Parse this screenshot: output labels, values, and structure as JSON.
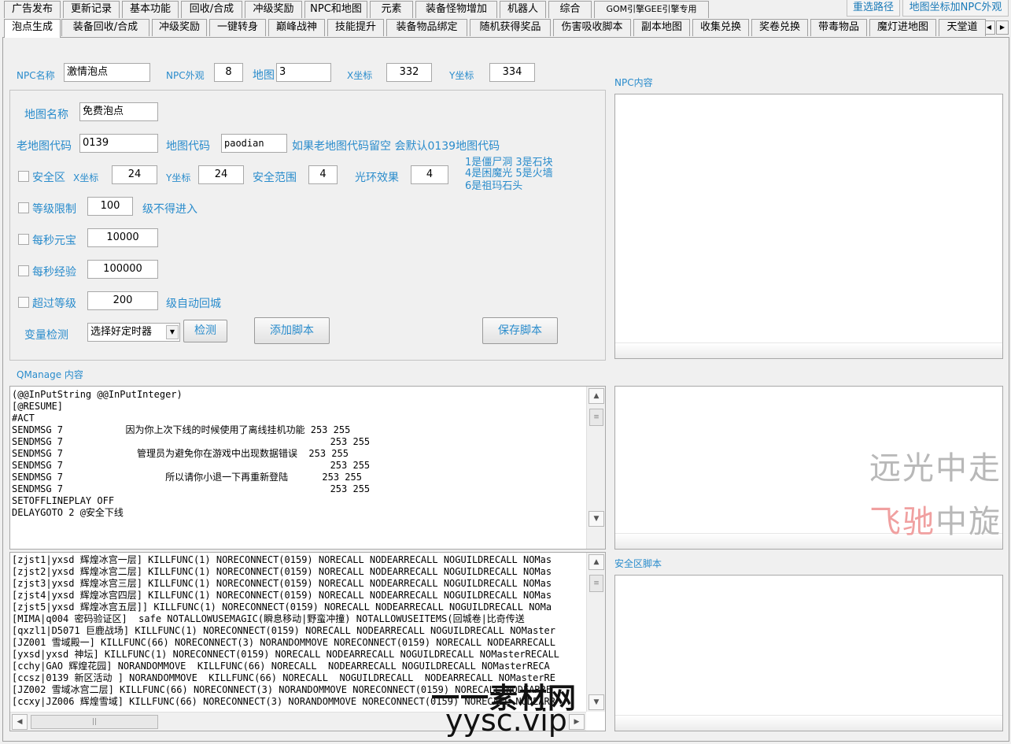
{
  "tabs_row1": [
    "广告发布",
    "更新记录",
    "基本功能",
    "回收/合成",
    "冲级奖励",
    "NPC和地图",
    "元素",
    "装备怪物增加",
    "机器人",
    "综合",
    "GOM引擎GEE引擎专用"
  ],
  "tabs_row1_right": [
    "重选路径",
    "地图坐标加NPC外观"
  ],
  "tabs_row2": [
    "泡点生成",
    "装备回收/合成",
    "冲级奖励",
    "一键转身",
    "巅峰战神",
    "技能提升",
    "装备物品绑定",
    "随机获得奖品",
    "伤害吸收脚本",
    "副本地图",
    "收集兑换",
    "奖卷兑换",
    "带毒物品",
    "魔灯进地图",
    "天堂道"
  ],
  "tab_scroll": {
    "left": "◀",
    "right": "▶"
  },
  "npc": {
    "name_label": "NPC名称",
    "name_value": "激情泡点",
    "look_label": "NPC外观",
    "look_value": "8",
    "map_label": "地图",
    "map_value": "3",
    "x_label": "X坐标",
    "x_value": "332",
    "y_label": "Y坐标",
    "y_value": "334",
    "content_label": "NPC内容"
  },
  "group": {
    "map_name_label": "地图名称",
    "map_name_value": "免费泡点",
    "old_map_code_label": "老地图代码",
    "old_map_code_value": "0139",
    "map_code_label": "地图代码",
    "map_code_value": "paodian",
    "hint": "如果老地图代码留空 会默认0139地图代码",
    "safe_label": "安全区",
    "safe_x_label": "X坐标",
    "safe_x_value": "24",
    "safe_y_label": "Y坐标",
    "safe_y_value": "24",
    "safe_range_label": "安全范围",
    "safe_range_value": "4",
    "halo_label": "光环效果",
    "halo_value": "4",
    "halo_hint": [
      "1是僵尸洞 3是石块",
      "4是困魔光 5是火墙",
      "6是祖玛石头"
    ],
    "level_limit_label": "等级限制",
    "level_limit_value": "100",
    "level_limit_suffix": "级不得进入",
    "yb_label": "每秒元宝",
    "yb_value": "10000",
    "exp_label": "每秒经验",
    "exp_value": "100000",
    "over_label": "超过等级",
    "over_value": "200",
    "over_suffix": "级自动回城",
    "var_label": "变量检测",
    "var_select": "选择好定时器",
    "check_btn": "检测",
    "add_btn": "添加脚本",
    "save_btn": "保存脚本"
  },
  "qmanage": {
    "label": "QManage 内容",
    "lines": [
      "(@@InPutString @@InPutInteger)",
      "[@RESUME]",
      "#ACT",
      "SENDMSG 7           因为你上次下线的时候使用了离线挂机功能 253 255",
      "SENDMSG 7                                               253 255",
      "SENDMSG 7             管理员为避免你在游戏中出现数据错误  253 255",
      "SENDMSG 7                                               253 255",
      "SENDMSG 7                  所以请你小退一下再重新登陆      253 255",
      "SENDMSG 7                                               253 255",
      "SETOFFLINEPLAY OFF",
      "DELAYGOTO 2 @安全下线"
    ]
  },
  "maplist": {
    "lines": [
      "[zjst1|yxsd 辉煌冰宫一层] KILLFUNC(1) NORECONNECT(0159) NORECALL NODEARRECALL NOGUILDRECALL NOMas",
      "[zjst2|yxsd 辉煌冰宫二层] KILLFUNC(1) NORECONNECT(0159) NORECALL NODEARRECALL NOGUILDRECALL NOMas",
      "[zjst3|yxsd 辉煌冰宫三层] KILLFUNC(1) NORECONNECT(0159) NORECALL NODEARRECALL NOGUILDRECALL NOMas",
      "[zjst4|yxsd 辉煌冰宫四层] KILLFUNC(1) NORECONNECT(0159) NORECALL NODEARRECALL NOGUILDRECALL NOMas",
      "[zjst5|yxsd 辉煌冰宫五层]] KILLFUNC(1) NORECONNECT(0159) NORECALL NODEARRECALL NOGUILDRECALL NOMa",
      "[MIMA|q004 密码验证区]  safe NOTALLOWUSEMAGIC(瞬息移动|野蛮冲撞) NOTALLOWUSEITEMS(回城卷|比奇传送",
      "[qxzl1|D5071 巨鹿战场] KILLFUNC(1) NORECONNECT(0159) NORECALL NODEARRECALL NOGUILDRECALL NOMaster",
      "[JZ001 雪域殿一] KILLFUNC(66) NORECONNECT(3) NORANDOMMOVE NORECONNECT(0159) NORECALL NODEARRECALL",
      "[yxsd|yxsd 神坛] KILLFUNC(1) NORECONNECT(0159) NORECALL NODEARRECALL NOGUILDRECALL NOMasterRECALL",
      "[cchy|GAO 辉煌花园] NORANDOMMOVE  KILLFUNC(66) NORECALL  NODEARRECALL NOGUILDRECALL NOMasterRECA",
      "[ccsz|0139 新区活动 ] NORANDOMMOVE  KILLFUNC(66) NORECALL  NOGUILDRECALL  NODEARRECALL NOMasterRE",
      "[JZ002 雪域冰宫二层] KILLFUNC(66) NORECONNECT(3) NORANDOMMOVE NORECONNECT(0159) NORECALL NODEARRE",
      "[ccxy|JZ006 辉煌雪域] KILLFUNC(66) NORECONNECT(3) NORANDOMMOVE NORECONNECT(0159) NORECALL NODEARR"
    ]
  },
  "safe_script_label": "安全区脚本",
  "watermarks": {
    "line1": "远光中走",
    "line2_red": "飞驰",
    "line2_gray": "中旋",
    "site_cn": "一一素材网",
    "site_en": "yysc.vip"
  }
}
